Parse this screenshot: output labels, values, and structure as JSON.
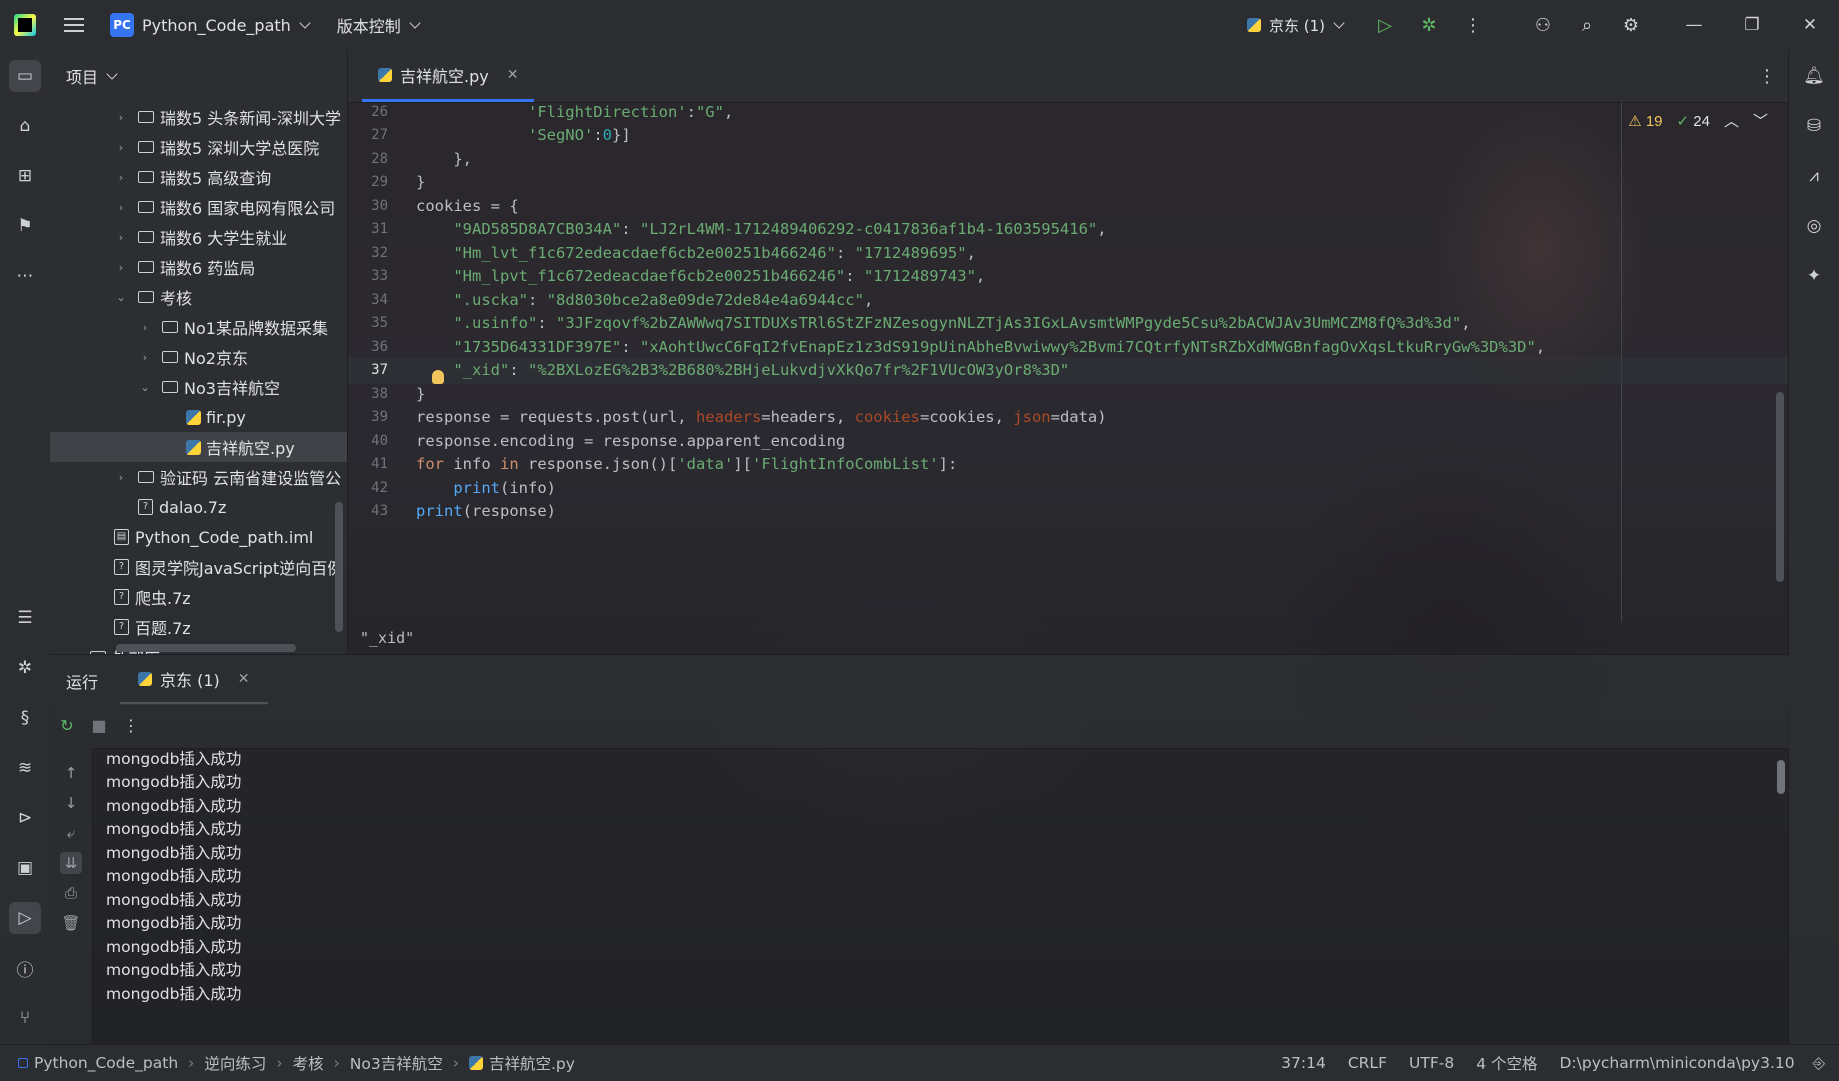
{
  "titlebar": {
    "project_badge": "PC",
    "project_name": "Python_Code_path",
    "vcs_label": "版本控制",
    "run_config": "京东 (1)"
  },
  "project_panel": {
    "title": "项目",
    "tree": [
      {
        "label": "瑞数5 头条新闻-深圳大学",
        "type": "folder",
        "expanded": false
      },
      {
        "label": "瑞数5 深圳大学总医院",
        "type": "folder",
        "expanded": false
      },
      {
        "label": "瑞数5 高级查询",
        "type": "folder",
        "expanded": false
      },
      {
        "label": "瑞数6 国家电网有限公司",
        "type": "folder",
        "expanded": false
      },
      {
        "label": "瑞数6 大学生就业",
        "type": "folder",
        "expanded": false
      },
      {
        "label": "瑞数6 药监局",
        "type": "folder",
        "expanded": false
      },
      {
        "label": "考核",
        "type": "folder",
        "expanded": true
      },
      {
        "label": "No1某品牌数据采集",
        "type": "folder",
        "expanded": false
      },
      {
        "label": "No2京东",
        "type": "folder",
        "expanded": false
      },
      {
        "label": "No3吉祥航空",
        "type": "folder",
        "expanded": true
      },
      {
        "label": "fir.py",
        "type": "py"
      },
      {
        "label": "吉祥航空.py",
        "type": "py",
        "selected": true
      },
      {
        "label": "验证码 云南省建设监管公",
        "type": "folder",
        "expanded": false
      },
      {
        "label": "dalao.7z",
        "type": "unknown"
      },
      {
        "label": "Python_Code_path.iml",
        "type": "iml"
      },
      {
        "label": "图灵学院JavaScript逆向百例",
        "type": "unknown"
      },
      {
        "label": "爬虫.7z",
        "type": "unknown"
      },
      {
        "label": "百题.7z",
        "type": "unknown"
      },
      {
        "label": "外部库",
        "type": "lib",
        "expanded": false
      }
    ]
  },
  "editor": {
    "tab_label": "吉祥航空.py",
    "warnings": "19",
    "ok_count": "24",
    "breadcrumb": "\"_xid\"",
    "lines": [
      {
        "num": "26",
        "tokens": [
          [
            "code",
            "            "
          ],
          [
            "s",
            "'FlightDirection'"
          ],
          [
            "code",
            ":"
          ],
          [
            "s",
            "\"G\""
          ],
          [
            "code",
            ","
          ]
        ]
      },
      {
        "num": "27",
        "tokens": [
          [
            "code",
            "            "
          ],
          [
            "s",
            "'SegNO'"
          ],
          [
            "code",
            ":"
          ],
          [
            "n",
            "0"
          ],
          [
            "code",
            "}]"
          ]
        ]
      },
      {
        "num": "28",
        "tokens": [
          [
            "code",
            "    },"
          ]
        ]
      },
      {
        "num": "29",
        "tokens": [
          [
            "code",
            "}"
          ]
        ]
      },
      {
        "num": "30",
        "tokens": [
          [
            "code",
            "cookies = {"
          ]
        ]
      },
      {
        "num": "31",
        "tokens": [
          [
            "code",
            "    "
          ],
          [
            "s",
            "\"9AD585D8A7CB034A\""
          ],
          [
            "code",
            ": "
          ],
          [
            "s",
            "\"LJ2rL4WM-1712489406292-c0417836af1b4-1603595416\""
          ],
          [
            "code",
            ","
          ]
        ]
      },
      {
        "num": "32",
        "tokens": [
          [
            "code",
            "    "
          ],
          [
            "s",
            "\"Hm_lvt_f1c672edeacdaef6cb2e00251b466246\""
          ],
          [
            "code",
            ": "
          ],
          [
            "s",
            "\"1712489695\""
          ],
          [
            "code",
            ","
          ]
        ]
      },
      {
        "num": "33",
        "tokens": [
          [
            "code",
            "    "
          ],
          [
            "s",
            "\"Hm_lpvt_f1c672edeacdaef6cb2e00251b466246\""
          ],
          [
            "code",
            ": "
          ],
          [
            "s",
            "\"1712489743\""
          ],
          [
            "code",
            ","
          ]
        ]
      },
      {
        "num": "34",
        "tokens": [
          [
            "code",
            "    "
          ],
          [
            "s",
            "\".uscka\""
          ],
          [
            "code",
            ": "
          ],
          [
            "s",
            "\"8d8030bce2a8e09de72de84e4a6944cc\""
          ],
          [
            "code",
            ","
          ]
        ]
      },
      {
        "num": "35",
        "tokens": [
          [
            "code",
            "    "
          ],
          [
            "s",
            "\".usinfo\""
          ],
          [
            "code",
            ": "
          ],
          [
            "s",
            "\"3JFzqovf%2bZAWWwq7SITDUXsTRl6StZFzNZesogynNLZTjAs3IGxLAvsmtWMPgyde5Csu%2bACWJAv3UmMCZM8fQ%3d%3d\""
          ],
          [
            "code",
            ","
          ]
        ]
      },
      {
        "num": "36",
        "tokens": [
          [
            "code",
            "    "
          ],
          [
            "s",
            "\"1735D64331DF397E\""
          ],
          [
            "code",
            ": "
          ],
          [
            "s",
            "\"xAohtUwcC6FqI2fvEnapEz1z3dS919pUinAbheBvwiwwy%2Bvmi7CQtrfyNTsRZbXdMWGBnfagOvXqsLtkuRryGw%3D%3D\""
          ],
          [
            "code",
            ","
          ]
        ]
      },
      {
        "num": "37",
        "tokens": [
          [
            "code",
            "    "
          ],
          [
            "s",
            "\"_xid\""
          ],
          [
            "code",
            ": "
          ],
          [
            "s",
            "\"%2BXLozEG%2B3%2B680%2BHjeLukvdjvXkQo7fr%2F1VUcOW3yOr8%3D\""
          ]
        ],
        "current": true
      },
      {
        "num": "38",
        "tokens": [
          [
            "code",
            "}"
          ]
        ]
      },
      {
        "num": "39",
        "tokens": [
          [
            "code",
            "response = requests.post(url, "
          ],
          [
            "p",
            "headers"
          ],
          [
            "code",
            "=headers, "
          ],
          [
            "p",
            "cookies"
          ],
          [
            "code",
            "=cookies, "
          ],
          [
            "p",
            "json"
          ],
          [
            "code",
            "=data)"
          ]
        ]
      },
      {
        "num": "40",
        "tokens": [
          [
            "code",
            "response.encoding = response.apparent_encoding"
          ]
        ]
      },
      {
        "num": "41",
        "tokens": [
          [
            "k",
            "for"
          ],
          [
            "code",
            " info "
          ],
          [
            "k",
            "in"
          ],
          [
            "code",
            " response.json()["
          ],
          [
            "s",
            "'data'"
          ],
          [
            "code",
            "]["
          ],
          [
            "s",
            "'FlightInfoCombList'"
          ],
          [
            "code",
            "]:"
          ]
        ]
      },
      {
        "num": "42",
        "tokens": [
          [
            "code",
            "    "
          ],
          [
            "f",
            "print"
          ],
          [
            "code",
            "(info)"
          ]
        ]
      },
      {
        "num": "43",
        "tokens": [
          [
            "f",
            "print"
          ],
          [
            "code",
            "(response)"
          ]
        ]
      }
    ]
  },
  "run_panel": {
    "title": "运行",
    "tab_label": "京东 (1)",
    "console_lines": [
      "mongodb插入成功",
      "mongodb插入成功",
      "mongodb插入成功",
      "mongodb插入成功",
      "mongodb插入成功",
      "mongodb插入成功",
      "mongodb插入成功",
      "mongodb插入成功",
      "mongodb插入成功",
      "mongodb插入成功",
      "mongodb插入成功"
    ]
  },
  "statusbar": {
    "crumbs": [
      "Python_Code_path",
      "逆向练习",
      "考核",
      "No3吉祥航空",
      "吉祥航空.py"
    ],
    "position": "37:14",
    "line_sep": "CRLF",
    "encoding": "UTF-8",
    "indent": "4 个空格",
    "interpreter": "D:\\pycharm\\miniconda\\py3.10"
  },
  "colors": {
    "accent": "#3574f0",
    "string": "#6aab73",
    "keyword": "#cf8e6d",
    "number": "#2aacb8",
    "param": "#aa4926",
    "builtin": "#56a8f5"
  },
  "icons": {
    "left_strip": [
      "folder-icon",
      "learn-icon",
      "structure-icon",
      "bookmark-icon",
      "more-icon",
      "todo-icon",
      "debug-icon",
      "python-console-icon",
      "layers-icon",
      "services-icon",
      "terminal-icon",
      "run-icon",
      "problems-icon",
      "git-icon"
    ],
    "right_strip": [
      "notifications-icon",
      "database-icon",
      "sciview-icon",
      "endpoints-icon",
      "ai-assistant-icon"
    ]
  }
}
